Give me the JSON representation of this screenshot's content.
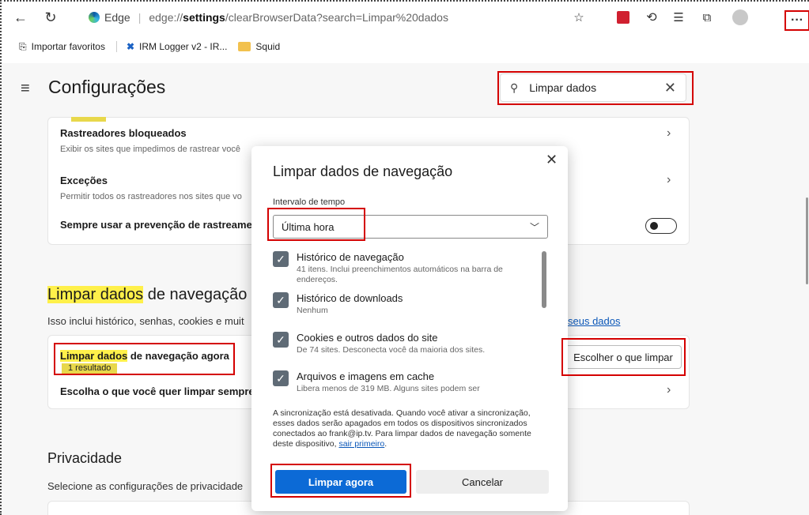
{
  "browser": {
    "edge_label": "Edge",
    "url_host": "edge://",
    "url_strong": "settings",
    "url_rest": "/clearBrowserData?search=Limpar%20dados",
    "more_label": "···"
  },
  "favorites": [
    {
      "label": "Importar favoritos",
      "icon": "import-icon"
    },
    {
      "label": "IRM Logger v2 - IR...",
      "icon": "irm-logo-icon"
    },
    {
      "label": "Squid",
      "icon": "folder-icon"
    }
  ],
  "settings": {
    "title": "Configurações",
    "search_value": "Limpar dados"
  },
  "tracking_card": {
    "blocked_title": "Rastreadores bloqueados",
    "blocked_sub": "Exibir os sites que impedimos de rastrear você",
    "exceptions_title": "Exceções",
    "exceptions_sub": "Permitir todos os rastreadores nos sites que vo",
    "always_title": "Sempre usar a prevenção de rastreamen"
  },
  "clear_section": {
    "title_highlight": "Limpar dados",
    "title_rest": " de navegação -",
    "desc": "Isso inclui histórico, senhas, cookies e muit",
    "link_fragment": "seus dados",
    "now_highlight": "Limpar dados",
    "now_rest": " de navegação agora",
    "result_tag": "1 resultado",
    "choose_button": "Escolher o que limpar",
    "always_title": "Escolha o que você quer limpar sempre"
  },
  "privacy": {
    "title": "Privacidade",
    "desc": "Selecione as configurações de privacidade"
  },
  "dialog": {
    "title": "Limpar dados de navegação",
    "interval_label": "Intervalo de tempo",
    "interval_value": "Última hora",
    "options": [
      {
        "title": "Histórico de navegação",
        "desc": "41 itens. Inclui preenchimentos automáticos na barra de endereços.",
        "checked": true
      },
      {
        "title": "Histórico de downloads",
        "desc": "Nenhum",
        "checked": true
      },
      {
        "title": "Cookies e outros dados do site",
        "desc": "De 74 sites. Desconecta você da maioria dos sites.",
        "checked": true
      },
      {
        "title": "Arquivos e imagens em cache",
        "desc": "Libera menos de 319 MB. Alguns sites podem ser",
        "checked": true
      }
    ],
    "sync_text": "A sincronização está desativada. Quando você ativar a sincronização, esses dados serão apagados em todos os dispositivos sincronizados conectados ao frank@ip.tv. Para limpar dados de navegação somente deste dispositivo, ",
    "sync_link": "sair primeiro",
    "sync_end": ".",
    "clear_button": "Limpar agora",
    "cancel_button": "Cancelar"
  },
  "colors": {
    "primary": "#0c6ad6",
    "annotation_red": "#d40000",
    "highlight": "#fff04a"
  }
}
